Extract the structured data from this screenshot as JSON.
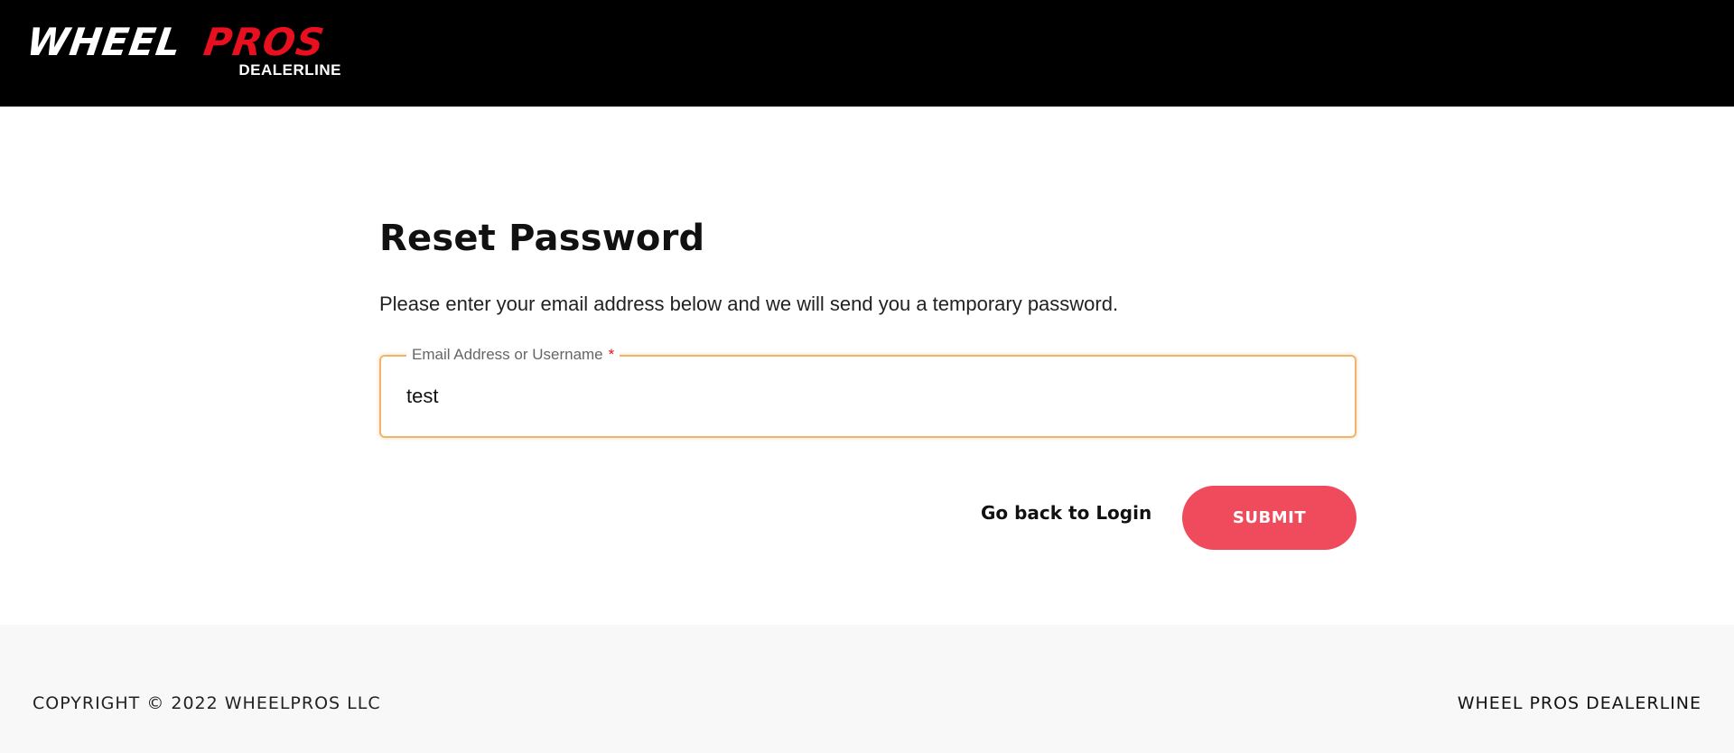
{
  "header": {
    "logo": {
      "word_primary": "WHEEL",
      "word_accent": "PROS",
      "subtitle": "DEALERLINE"
    }
  },
  "main": {
    "title": "Reset Password",
    "instructions": "Please enter your email address below and we will send you a temporary password.",
    "email_field": {
      "label": "Email Address or Username",
      "required_marker": "*",
      "value": "test"
    },
    "back_link_label": "Go back to Login",
    "submit_label": "SUBMIT"
  },
  "footer": {
    "copyright": "COPYRIGHT © 2022 WHEELPROS LLC",
    "brand_link": "WHEEL PROS DEALERLINE"
  },
  "colors": {
    "header_bg": "#000000",
    "accent_red": "#e8101e",
    "submit_bg": "#ef4b5c",
    "field_focus_border": "#f0b56a",
    "footer_bg": "#f8f8f8"
  }
}
